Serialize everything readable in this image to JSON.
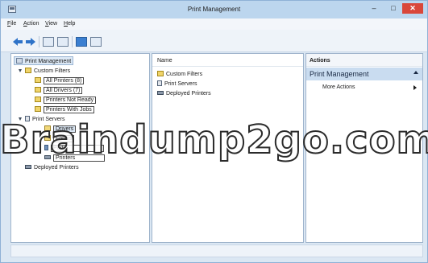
{
  "window": {
    "title": "Print Management",
    "minimize_glyph": "–",
    "maximize_glyph": "□",
    "close_glyph": "✕"
  },
  "menu": {
    "items": [
      "File",
      "Action",
      "View",
      "Help"
    ]
  },
  "toolbar": {
    "icons": [
      "back-arrow-icon",
      "forward-arrow-icon",
      "show-hide-tree-icon",
      "export-list-icon",
      "help-icon",
      "show-action-pane-icon"
    ]
  },
  "tree": {
    "root": "Print Management",
    "custom_filters": {
      "label": "Custom Filters",
      "children": [
        "All Printers (8)",
        "All Drivers (7)",
        "Printers Not Ready",
        "Printers With Jobs"
      ]
    },
    "print_servers": {
      "label": "Print Servers",
      "server_children": [
        "Drivers",
        "Forms",
        "Ports",
        "Printers"
      ]
    },
    "deployed_printers": "Deployed Printers"
  },
  "list": {
    "column_name": "Name",
    "items": [
      "Custom Filters",
      "Print Servers",
      "Deployed Printers"
    ]
  },
  "actions": {
    "header": "Actions",
    "section": "Print Management",
    "more_actions": "More Actions"
  },
  "watermark": "Braindump2go.com",
  "colors": {
    "titlebar": "#bcd6ee",
    "close_button": "#d9473a",
    "actions_section": "#c9dcf0"
  }
}
